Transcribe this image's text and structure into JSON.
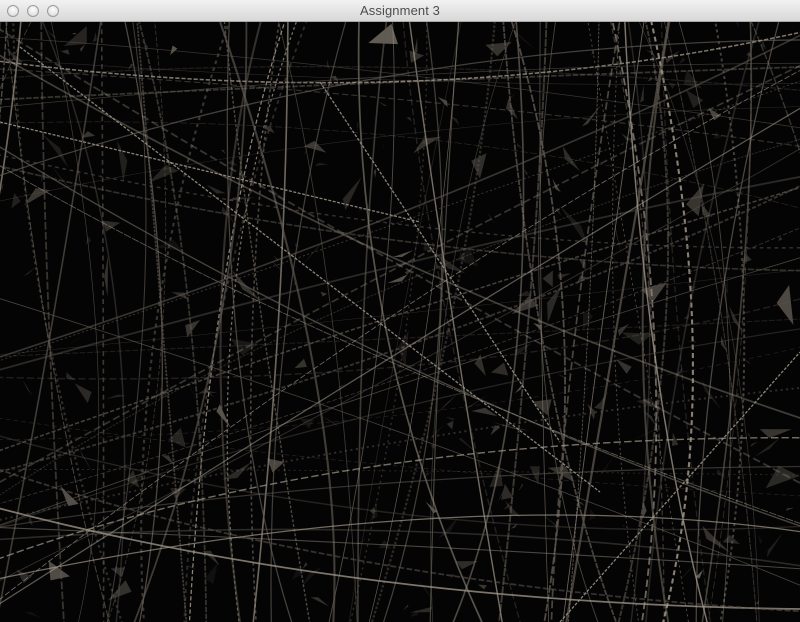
{
  "window": {
    "title": "Assignment 3"
  },
  "traffic_lights": {
    "close": "close-button",
    "minimize": "minimize-button",
    "zoom": "zoom-button"
  },
  "colors": {
    "background": "#000000",
    "strand": "#a39a8c",
    "strand_dim": "#5e5850"
  }
}
